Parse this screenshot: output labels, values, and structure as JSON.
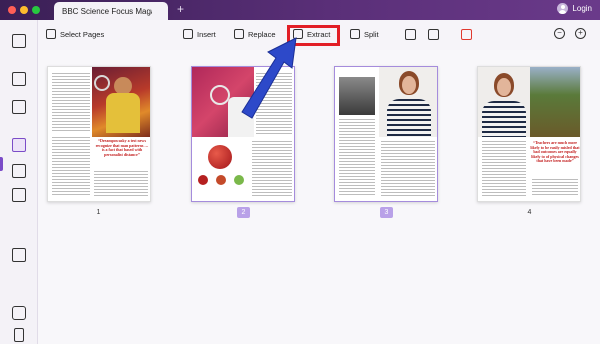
{
  "window": {
    "tab_title": "BBC Science Focus Magaz",
    "tab_close": "×",
    "new_tab": "+",
    "login_label": "Login"
  },
  "toolbar": {
    "select_pages": "Select Pages",
    "insert": "Insert",
    "replace": "Replace",
    "extract": "Extract",
    "split": "Split"
  },
  "pages": [
    {
      "number": "1",
      "selected": false,
      "quote": "“Dreampowasky a test news recognize that man patterns … is a fact that based with personalist distance”"
    },
    {
      "number": "2",
      "selected": true
    },
    {
      "number": "3",
      "selected": true
    },
    {
      "number": "4",
      "selected": false,
      "quote": "“Teachers are much more likely to be easily misled that bad outcomes are equally likely to of physical changes that have been made”"
    }
  ],
  "colors": {
    "accent": "#7b4cc8",
    "highlight_box": "#e21e26",
    "arrow": "#2d49c9"
  }
}
